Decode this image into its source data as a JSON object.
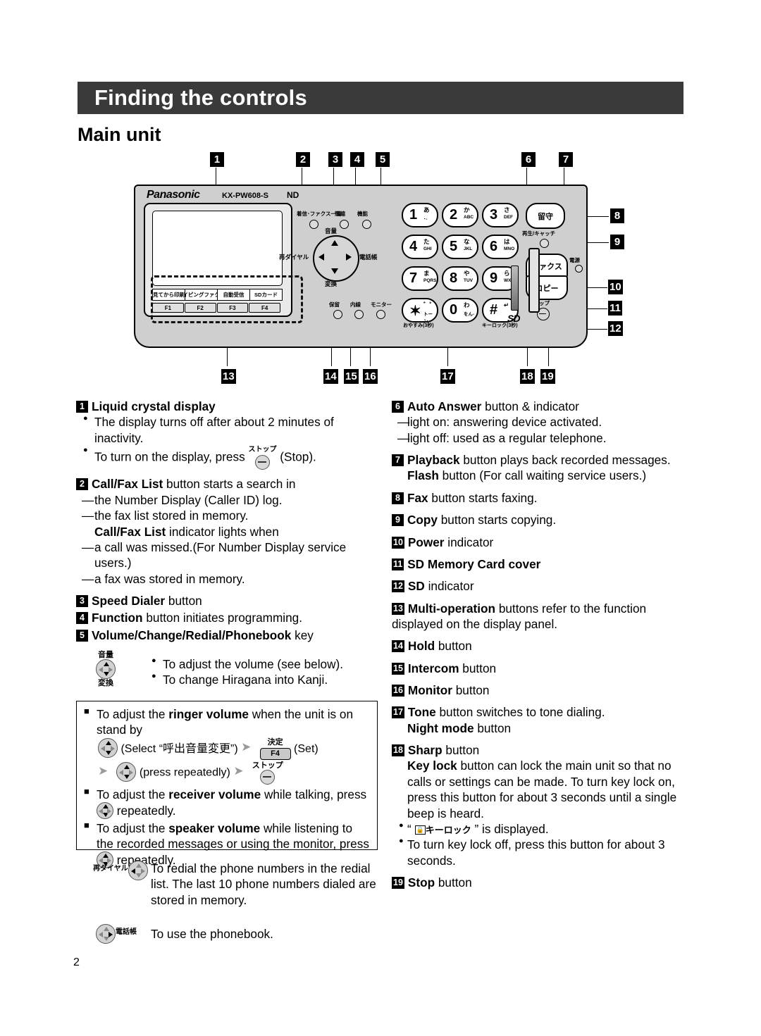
{
  "header": {
    "title": "Finding the controls",
    "subtitle": "Main unit"
  },
  "page": {
    "number": "2"
  },
  "device": {
    "brand": "Panasonic",
    "model": "KX-PW608-S",
    "nd_mark": "ND",
    "soft_keys": [
      "見てから印刷",
      "タイピングファクス",
      "自動受信",
      "SDカード"
    ],
    "function_keys": [
      "F1",
      "F2",
      "F3",
      "F4"
    ],
    "top_buttons": [
      {
        "label": "着信･ファクス一覧"
      },
      {
        "label": "短縮"
      },
      {
        "label": "機能"
      }
    ],
    "wheel": {
      "top": "音量",
      "left": "再ダイヤル",
      "right": "電話帳",
      "bottom": "変換"
    },
    "keypad": [
      {
        "n": "1",
        "jp": "あ",
        "ab": "･-"
      },
      {
        "n": "2",
        "jp": "か",
        "ab": "ABC"
      },
      {
        "n": "3",
        "jp": "さ",
        "ab": "DEF"
      },
      {
        "n": "4",
        "jp": "た",
        "ab": "GHI"
      },
      {
        "n": "5",
        "jp": "な",
        "ab": "JKL"
      },
      {
        "n": "6",
        "jp": "は",
        "ab": "MNO"
      },
      {
        "n": "7",
        "jp": "ま",
        "ab": "PQRS"
      },
      {
        "n": "8",
        "jp": "や",
        "ab": "TUV"
      },
      {
        "n": "9",
        "jp": "ら",
        "ab": "WXYZ"
      },
      {
        "n": "✶",
        "jp": "゛゜",
        "ab": "トーン"
      },
      {
        "n": "0",
        "jp": "わ",
        "ab": "をん-"
      },
      {
        "n": "#",
        "jp": "↵",
        "ab": ""
      }
    ],
    "keypad_sublabels": {
      "star": "おやすみ(3秒)",
      "hash": "キーロック(3秒)"
    },
    "right_buttons": {
      "answer": "留守",
      "playback": "再生/キャッチ",
      "fax": "ファクス",
      "copy": "コピー",
      "stop": "ストップ",
      "power": "電源"
    },
    "bottom_buttons": [
      {
        "label": "保留"
      },
      {
        "label": "内線"
      },
      {
        "label": "モニター"
      }
    ],
    "sd_logo": "SD"
  },
  "callouts_top": [
    "1",
    "2",
    "3",
    "4",
    "5",
    "6",
    "7"
  ],
  "callouts_right": [
    "8",
    "9",
    "10",
    "11",
    "12"
  ],
  "callouts_bottom": [
    "13",
    "14",
    "15",
    "16",
    "17",
    "18",
    "19"
  ],
  "left_column": {
    "item1": {
      "num": "1",
      "title": "Liquid crystal display",
      "bullet1": "The display turns off after about 2 minutes of inactivity.",
      "bullet2_pre": "To turn on the display, press",
      "bullet2_key_label": "ストップ",
      "bullet2_post": "(Stop)."
    },
    "item2": {
      "num": "2",
      "title": "Call/Fax List",
      "title_rest": "button starts a search in",
      "dash1": "the Number Display (Caller ID) log.",
      "dash2": "the fax list stored in memory.",
      "line3_bold": "Call/Fax List",
      "line3_rest": "indicator lights when",
      "dash3": "a call was missed.(For Number Display service users.)",
      "dash4": "a fax was stored in memory."
    },
    "item3": {
      "num": "3",
      "title": "Speed Dialer",
      "rest": "button"
    },
    "item4": {
      "num": "4",
      "title": "Function",
      "rest": "button initiates programming."
    },
    "item5": {
      "num": "5",
      "title": "Volume/Change/Redial/Phonebook",
      "rest": "key",
      "icon_top": "音量",
      "icon_bottom": "変換",
      "bullet1": "To adjust the volume (see below).",
      "bullet2": "To change Hiragana into Kanji."
    },
    "volume_box": {
      "sq1_pre": "To adjust the",
      "sq1_bold": "ringer volume",
      "sq1_post": "when the unit is on stand by",
      "step_select": "(Select “呼出音量変更”)",
      "step_set_top": "決定",
      "step_set_key": "F4",
      "step_set_label": "(Set)",
      "step_repeat": "(press repeatedly)",
      "step_stop_top": "ストップ",
      "sq2_pre": "To adjust the",
      "sq2_bold": "receiver volume",
      "sq2_mid": "while talking, press",
      "sq2_post": "repeatedly.",
      "sq3_pre": "To adjust the",
      "sq3_bold": "speaker volume",
      "sq3_mid": "while listening to the recorded messages or using the monitor, press",
      "sq3_post": "repeatedly."
    },
    "redial_row": {
      "icon_label": "再ダイヤル",
      "text": "To redial the phone numbers in the redial list. The last 10 phone numbers dialed are stored in memory."
    },
    "phonebook_row": {
      "icon_label": "電話帳",
      "text": "To use the phonebook."
    }
  },
  "right_column": {
    "item6": {
      "num": "6",
      "title": "Auto Answer",
      "rest": "button & indicator",
      "dash1": "light on:  answering device activated.",
      "dash2": "light off:  used as a regular telephone."
    },
    "item7": {
      "num": "7",
      "title": "Playback",
      "rest": "button plays back recorded messages.",
      "line2_bold": "Flash",
      "line2_rest": "button (For call waiting service users.)"
    },
    "item8": {
      "num": "8",
      "title": "Fax",
      "rest": "button starts faxing."
    },
    "item9": {
      "num": "9",
      "title": "Copy",
      "rest": "button starts copying."
    },
    "item10": {
      "num": "10",
      "title": "Power",
      "rest": "indicator"
    },
    "item11": {
      "num": "11",
      "title": "SD Memory Card cover",
      "rest": ""
    },
    "item12": {
      "num": "12",
      "title": "SD",
      "rest": "indicator"
    },
    "item13": {
      "num": "13",
      "title": "Multi-operation",
      "rest": "buttons refer to the function displayed on the display panel."
    },
    "item14": {
      "num": "14",
      "title": "Hold",
      "rest": "button"
    },
    "item15": {
      "num": "15",
      "title": "Intercom",
      "rest": "button"
    },
    "item16": {
      "num": "16",
      "title": "Monitor",
      "rest": "button"
    },
    "item17": {
      "num": "17",
      "title": "Tone",
      "rest": "button switches to tone dialing.",
      "line2_bold": "Night mode",
      "line2_rest": "button"
    },
    "item18": {
      "num": "18",
      "title": "Sharp",
      "rest": "button",
      "line2_bold": "Key lock",
      "line2_rest": "button can lock the main unit so that no calls or settings can be made. To turn key lock on, press this button for about 3 seconds until a single beep is heard.",
      "bullet1_pre": "“",
      "bullet1_icon": "キーロック",
      "bullet1_post": "” is displayed.",
      "bullet2": "To turn key lock off, press this button for about 3 seconds."
    },
    "item19": {
      "num": "19",
      "title": "Stop",
      "rest": "button"
    }
  }
}
